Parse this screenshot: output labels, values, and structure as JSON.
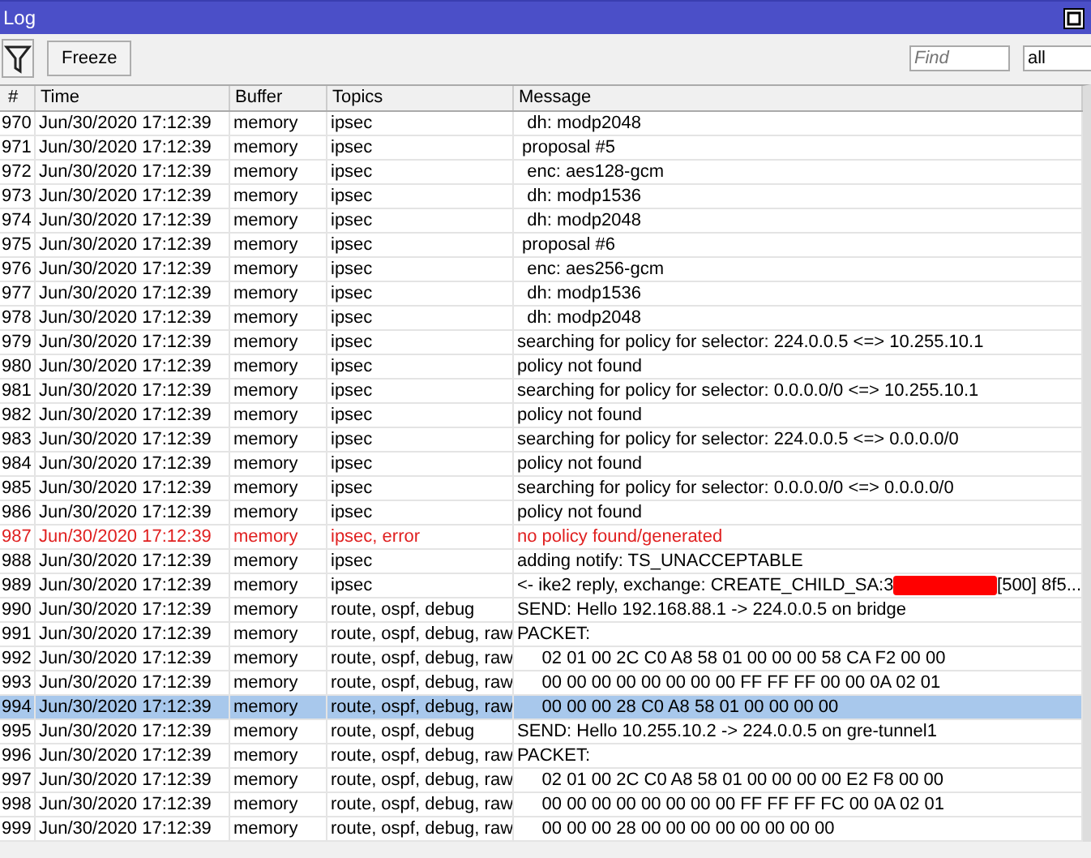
{
  "window": {
    "title": "Log"
  },
  "toolbar": {
    "freeze_label": "Freeze",
    "find_placeholder": "Find",
    "filter_value": "all"
  },
  "table": {
    "columns": [
      "#",
      "Time",
      "Buffer",
      "Topics",
      "Message"
    ],
    "rows": [
      {
        "num": "970",
        "time": "Jun/30/2020 17:12:39",
        "buffer": "memory",
        "topics": "ipsec",
        "message": "  dh: modp2048",
        "kind": "normal",
        "selected": false
      },
      {
        "num": "971",
        "time": "Jun/30/2020 17:12:39",
        "buffer": "memory",
        "topics": "ipsec",
        "message": " proposal #5",
        "kind": "normal",
        "selected": false
      },
      {
        "num": "972",
        "time": "Jun/30/2020 17:12:39",
        "buffer": "memory",
        "topics": "ipsec",
        "message": "  enc: aes128-gcm",
        "kind": "normal",
        "selected": false
      },
      {
        "num": "973",
        "time": "Jun/30/2020 17:12:39",
        "buffer": "memory",
        "topics": "ipsec",
        "message": "  dh: modp1536",
        "kind": "normal",
        "selected": false
      },
      {
        "num": "974",
        "time": "Jun/30/2020 17:12:39",
        "buffer": "memory",
        "topics": "ipsec",
        "message": "  dh: modp2048",
        "kind": "normal",
        "selected": false
      },
      {
        "num": "975",
        "time": "Jun/30/2020 17:12:39",
        "buffer": "memory",
        "topics": "ipsec",
        "message": " proposal #6",
        "kind": "normal",
        "selected": false
      },
      {
        "num": "976",
        "time": "Jun/30/2020 17:12:39",
        "buffer": "memory",
        "topics": "ipsec",
        "message": "  enc: aes256-gcm",
        "kind": "normal",
        "selected": false
      },
      {
        "num": "977",
        "time": "Jun/30/2020 17:12:39",
        "buffer": "memory",
        "topics": "ipsec",
        "message": "  dh: modp1536",
        "kind": "normal",
        "selected": false
      },
      {
        "num": "978",
        "time": "Jun/30/2020 17:12:39",
        "buffer": "memory",
        "topics": "ipsec",
        "message": "  dh: modp2048",
        "kind": "normal",
        "selected": false
      },
      {
        "num": "979",
        "time": "Jun/30/2020 17:12:39",
        "buffer": "memory",
        "topics": "ipsec",
        "message": "searching for policy for selector: 224.0.0.5 <=> 10.255.10.1",
        "kind": "normal",
        "selected": false
      },
      {
        "num": "980",
        "time": "Jun/30/2020 17:12:39",
        "buffer": "memory",
        "topics": "ipsec",
        "message": "policy not found",
        "kind": "normal",
        "selected": false
      },
      {
        "num": "981",
        "time": "Jun/30/2020 17:12:39",
        "buffer": "memory",
        "topics": "ipsec",
        "message": "searching for policy for selector: 0.0.0.0/0 <=> 10.255.10.1",
        "kind": "normal",
        "selected": false
      },
      {
        "num": "982",
        "time": "Jun/30/2020 17:12:39",
        "buffer": "memory",
        "topics": "ipsec",
        "message": "policy not found",
        "kind": "normal",
        "selected": false
      },
      {
        "num": "983",
        "time": "Jun/30/2020 17:12:39",
        "buffer": "memory",
        "topics": "ipsec",
        "message": "searching for policy for selector: 224.0.0.5 <=> 0.0.0.0/0",
        "kind": "normal",
        "selected": false
      },
      {
        "num": "984",
        "time": "Jun/30/2020 17:12:39",
        "buffer": "memory",
        "topics": "ipsec",
        "message": "policy not found",
        "kind": "normal",
        "selected": false
      },
      {
        "num": "985",
        "time": "Jun/30/2020 17:12:39",
        "buffer": "memory",
        "topics": "ipsec",
        "message": "searching for policy for selector: 0.0.0.0/0 <=> 0.0.0.0/0",
        "kind": "normal",
        "selected": false
      },
      {
        "num": "986",
        "time": "Jun/30/2020 17:12:39",
        "buffer": "memory",
        "topics": "ipsec",
        "message": "policy not found",
        "kind": "normal",
        "selected": false
      },
      {
        "num": "987",
        "time": "Jun/30/2020 17:12:39",
        "buffer": "memory",
        "topics": "ipsec, error",
        "message": "no policy found/generated",
        "kind": "error",
        "selected": false
      },
      {
        "num": "988",
        "time": "Jun/30/2020 17:12:39",
        "buffer": "memory",
        "topics": "ipsec",
        "message": "adding notify: TS_UNACCEPTABLE",
        "kind": "normal",
        "selected": false
      },
      {
        "num": "989",
        "time": "Jun/30/2020 17:12:39",
        "buffer": "memory",
        "topics": "ipsec",
        "message": "<- ike2 reply, exchange: CREATE_CHILD_SA:3",
        "message_after_redaction": "[500] 8f5...",
        "kind": "normal",
        "selected": false
      },
      {
        "num": "990",
        "time": "Jun/30/2020 17:12:39",
        "buffer": "memory",
        "topics": "route, ospf, debug",
        "message": "SEND: Hello 192.168.88.1 -> 224.0.0.5 on bridge",
        "kind": "normal",
        "selected": false
      },
      {
        "num": "991",
        "time": "Jun/30/2020 17:12:39",
        "buffer": "memory",
        "topics": "route, ospf, debug, raw",
        "message": "PACKET:",
        "kind": "normal",
        "selected": false
      },
      {
        "num": "992",
        "time": "Jun/30/2020 17:12:39",
        "buffer": "memory",
        "topics": "route, ospf, debug, raw",
        "message": "     02 01 00 2C C0 A8 58 01 00 00 00 58 CA F2 00 00",
        "kind": "normal",
        "selected": false
      },
      {
        "num": "993",
        "time": "Jun/30/2020 17:12:39",
        "buffer": "memory",
        "topics": "route, ospf, debug, raw",
        "message": "     00 00 00 00 00 00 00 00 FF FF FF 00 00 0A 02 01",
        "kind": "normal",
        "selected": false
      },
      {
        "num": "994",
        "time": "Jun/30/2020 17:12:39",
        "buffer": "memory",
        "topics": "route, ospf, debug, raw",
        "message": "     00 00 00 28 C0 A8 58 01 00 00 00 00",
        "kind": "normal",
        "selected": true
      },
      {
        "num": "995",
        "time": "Jun/30/2020 17:12:39",
        "buffer": "memory",
        "topics": "route, ospf, debug",
        "message": "SEND: Hello 10.255.10.2 -> 224.0.0.5 on gre-tunnel1",
        "kind": "normal",
        "selected": false
      },
      {
        "num": "996",
        "time": "Jun/30/2020 17:12:39",
        "buffer": "memory",
        "topics": "route, ospf, debug, raw",
        "message": "PACKET:",
        "kind": "normal",
        "selected": false
      },
      {
        "num": "997",
        "time": "Jun/30/2020 17:12:39",
        "buffer": "memory",
        "topics": "route, ospf, debug, raw",
        "message": "     02 01 00 2C C0 A8 58 01 00 00 00 00 E2 F8 00 00",
        "kind": "normal",
        "selected": false
      },
      {
        "num": "998",
        "time": "Jun/30/2020 17:12:39",
        "buffer": "memory",
        "topics": "route, ospf, debug, raw",
        "message": "     00 00 00 00 00 00 00 00 FF FF FF FC 00 0A 02 01",
        "kind": "normal",
        "selected": false
      },
      {
        "num": "999",
        "time": "Jun/30/2020 17:12:39",
        "buffer": "memory",
        "topics": "route, ospf, debug, raw",
        "message": "     00 00 00 28 00 00 00 00 00 00 00 00",
        "kind": "normal",
        "selected": false
      }
    ]
  }
}
